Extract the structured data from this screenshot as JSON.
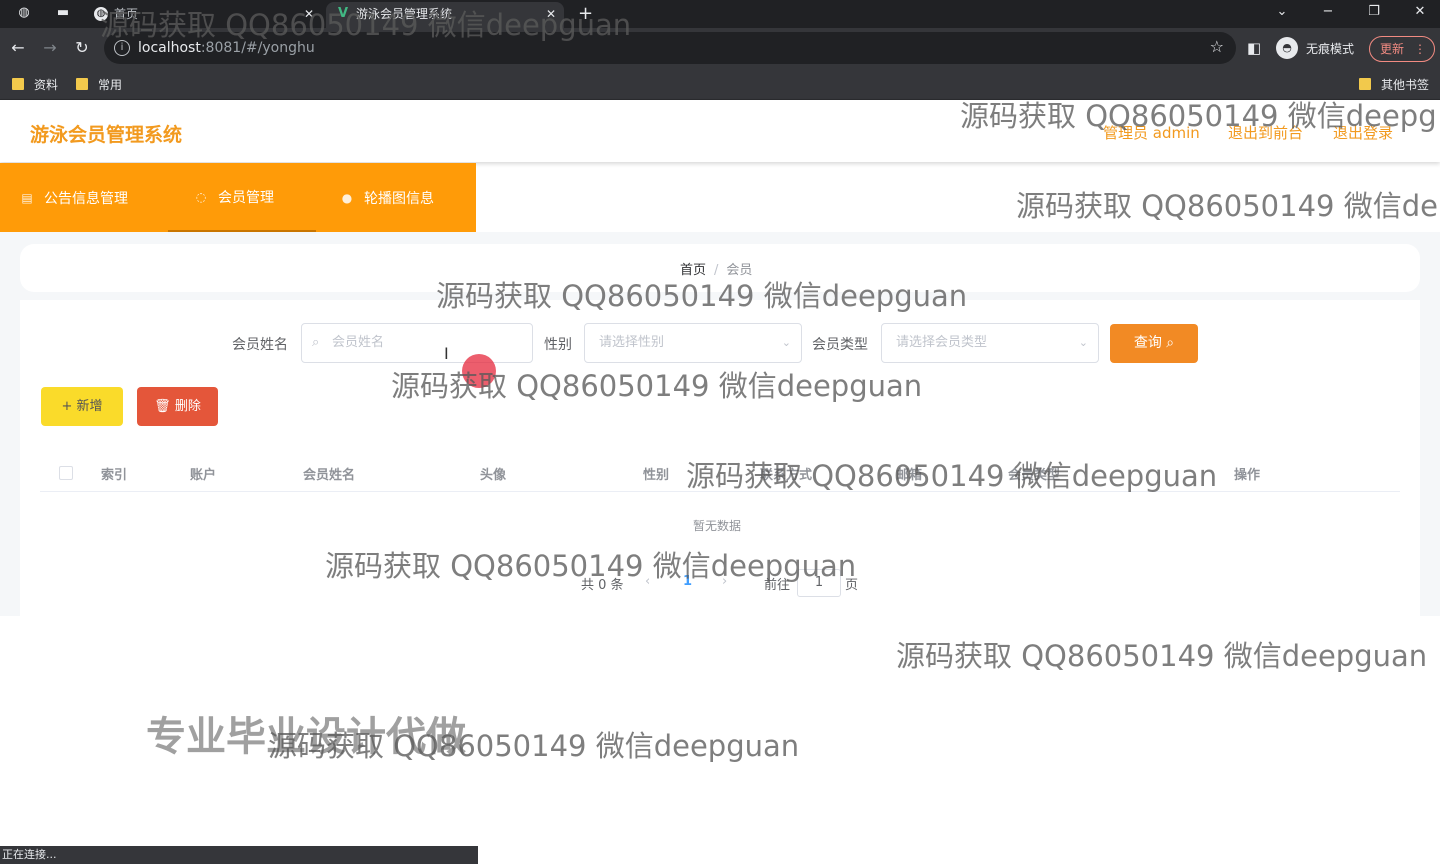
{
  "browser": {
    "tabs": [
      {
        "title": "首页",
        "active": false
      },
      {
        "title": "游泳会员管理系统",
        "active": true
      }
    ],
    "url_host": "localhost",
    "url_rest": ":8081/#/yonghu",
    "incognito_label": "无痕模式",
    "update_label": "更新",
    "bookmarks": [
      "资料",
      "常用"
    ],
    "other_bookmarks": "其他书签",
    "status_text": "正在连接..."
  },
  "app": {
    "title": "游泳会员管理系统",
    "header_links": [
      "管理员 admin",
      "退出到前台",
      "退出登录"
    ],
    "menu": [
      {
        "label": "公告信息管理",
        "icon": "notice-icon"
      },
      {
        "label": "会员管理",
        "icon": "member-icon",
        "active": true
      },
      {
        "label": "轮播图信息",
        "icon": "user-icon"
      }
    ],
    "breadcrumb": {
      "home": "首页",
      "separator": "/",
      "current": "会员"
    }
  },
  "search": {
    "name_label": "会员姓名",
    "name_placeholder": "会员姓名",
    "gender_label": "性别",
    "gender_placeholder": "请选择性别",
    "type_label": "会员类型",
    "type_placeholder": "请选择会员类型",
    "query_button": "查询"
  },
  "actions": {
    "add": "新增",
    "delete": "删除"
  },
  "table": {
    "columns": [
      "索引",
      "账户",
      "会员姓名",
      "头像",
      "性别",
      "联系方式",
      "邮箱",
      "会员类型",
      "操作"
    ],
    "empty_text": "暂无数据"
  },
  "pagination": {
    "total": "共 0 条",
    "prev": "‹",
    "current": "1",
    "next": "›",
    "goto_label": "前往",
    "goto_value": "1",
    "page_suffix": "页"
  },
  "watermarks": [
    "源码获取 QQ86050149 微信deepguan",
    "源码获取 QQ86050149 微信deepguan",
    "源码获取 QQ86050149 微信de",
    "源码获取 QQ86050149 微信deepguan",
    "源码获取 QQ86050149 微信deepguan",
    "源码获取 QQ86050149 微信deepguan",
    "源码获取 QQ86050149 微信deepguan",
    "源码获取 QQ86050149 微信deepguan",
    "源码获取 QQ86050149 微信deepg"
  ],
  "promo_text": "专业毕业设计代做",
  "colors": {
    "accent": "#ff9b08",
    "query": "#f28a24",
    "add": "#fadb2a",
    "delete": "#e4563a"
  }
}
